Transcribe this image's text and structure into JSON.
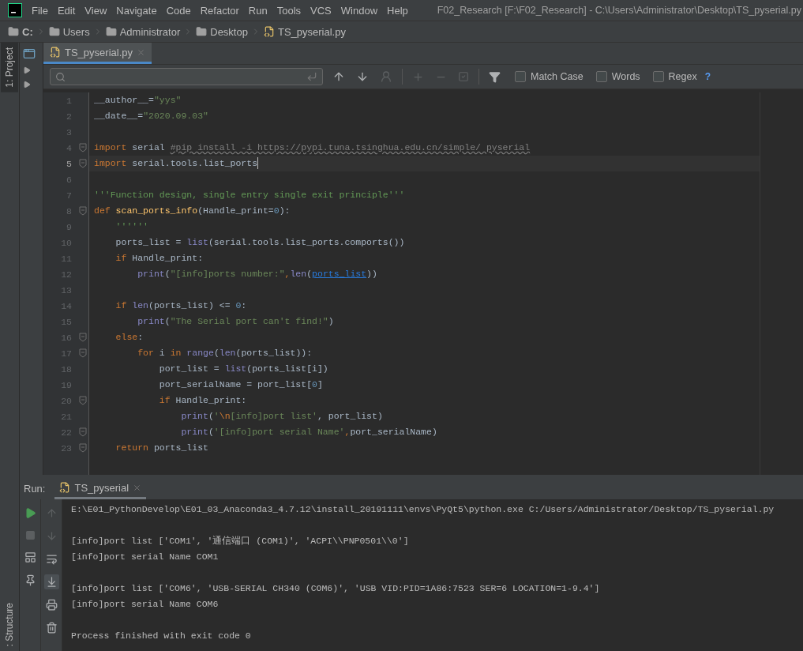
{
  "window": {
    "title": "F02_Research [F:\\F02_Research] - C:\\Users\\Administrator\\Desktop\\TS_pyserial.py"
  },
  "menu": [
    "File",
    "Edit",
    "View",
    "Navigate",
    "Code",
    "Refactor",
    "Run",
    "Tools",
    "VCS",
    "Window",
    "Help"
  ],
  "breadcrumb": [
    {
      "label": "C:",
      "kind": "folder"
    },
    {
      "label": "Users",
      "kind": "folder"
    },
    {
      "label": "Administrator",
      "kind": "folder"
    },
    {
      "label": "Desktop",
      "kind": "folder"
    },
    {
      "label": "TS_pyserial.py",
      "kind": "file"
    }
  ],
  "side_tools": {
    "top": "1: Project",
    "bottom": ": Structure"
  },
  "editor_tabs": [
    {
      "label": "TS_pyserial.py",
      "selected": true
    }
  ],
  "find": {
    "options": [
      {
        "label": "Match Case",
        "checked": false
      },
      {
        "label": "Words",
        "checked": false
      },
      {
        "label": "Regex",
        "checked": false
      }
    ],
    "help": "?"
  },
  "code": [
    {
      "n": "1",
      "current": false,
      "fold": false,
      "tokens": [
        {
          "text": "__author__=",
          "kind": "plain"
        },
        {
          "text": "\"yys\"",
          "kind": "string"
        }
      ]
    },
    {
      "n": "2",
      "current": false,
      "fold": false,
      "tokens": [
        {
          "text": "__date__=",
          "kind": "plain"
        },
        {
          "text": "\"2020.09.03\"",
          "kind": "string"
        }
      ]
    },
    {
      "n": "3",
      "current": false,
      "fold": false
    },
    {
      "n": "4",
      "current": false,
      "fold": true,
      "tokens": [
        {
          "text": "import",
          "kind": "keyword"
        },
        {
          "text": " serial ",
          "kind": "plain"
        },
        {
          "text": "#pip install -i https://pypi.tuna.tsinghua.edu.cn/simple/ pyserial",
          "kind": "comment"
        }
      ]
    },
    {
      "n": "5",
      "current": true,
      "fold": true,
      "tokens": [
        {
          "text": "import",
          "kind": "keyword"
        },
        {
          "text": " serial.tools.list_ports",
          "kind": "plain"
        }
      ]
    },
    {
      "n": "6",
      "current": false,
      "fold": false
    },
    {
      "n": "7",
      "current": false,
      "fold": false,
      "tokens": [
        {
          "text": "'''Function design, single entry single exit principle'''",
          "kind": "doc"
        }
      ]
    },
    {
      "n": "8",
      "current": false,
      "fold": true,
      "tokens": [
        {
          "text": "def ",
          "kind": "keyword"
        },
        {
          "text": "scan_ports_info",
          "kind": "function"
        },
        {
          "text": "(Handle_print=",
          "kind": "plain"
        },
        {
          "text": "0",
          "kind": "number"
        },
        {
          "text": "):",
          "kind": "plain"
        }
      ]
    },
    {
      "n": "9",
      "current": false,
      "fold": false,
      "tokens": [
        {
          "text": "    ''''''",
          "kind": "doc"
        }
      ]
    },
    {
      "n": "10",
      "current": false,
      "fold": false,
      "tokens": [
        {
          "text": "    ports_list = ",
          "kind": "plain"
        },
        {
          "text": "list",
          "kind": "builtin"
        },
        {
          "text": "(serial.tools.list_ports.comports())",
          "kind": "plain"
        }
      ]
    },
    {
      "n": "11",
      "current": false,
      "fold": false,
      "tokens": [
        {
          "text": "    if",
          "kind": "keyword"
        },
        {
          "text": " Handle_print:",
          "kind": "plain"
        }
      ]
    },
    {
      "n": "12",
      "current": false,
      "fold": false,
      "tokens": [
        {
          "text": "        print",
          "kind": "builtin"
        },
        {
          "text": "(",
          "kind": "plain"
        },
        {
          "text": "\"[info]ports number:\"",
          "kind": "string"
        },
        {
          "text": ",",
          "kind": "keyword"
        },
        {
          "text": "len",
          "kind": "builtin"
        },
        {
          "text": "(",
          "kind": "plain"
        },
        {
          "text": "ports_list",
          "kind": "link"
        },
        {
          "text": "))",
          "kind": "plain"
        }
      ]
    },
    {
      "n": "13",
      "current": false,
      "fold": false
    },
    {
      "n": "14",
      "current": false,
      "fold": false,
      "tokens": [
        {
          "text": "    if ",
          "kind": "keyword"
        },
        {
          "text": "len",
          "kind": "builtin"
        },
        {
          "text": "(ports_list) <= ",
          "kind": "plain"
        },
        {
          "text": "0",
          "kind": "number"
        },
        {
          "text": ":",
          "kind": "plain"
        }
      ]
    },
    {
      "n": "15",
      "current": false,
      "fold": false,
      "tokens": [
        {
          "text": "        print",
          "kind": "builtin"
        },
        {
          "text": "(",
          "kind": "plain"
        },
        {
          "text": "\"The Serial port can't find!\"",
          "kind": "string"
        },
        {
          "text": ")",
          "kind": "plain"
        }
      ]
    },
    {
      "n": "16",
      "current": false,
      "fold": true,
      "tokens": [
        {
          "text": "    else",
          "kind": "keyword"
        },
        {
          "text": ":",
          "kind": "plain"
        }
      ]
    },
    {
      "n": "17",
      "current": false,
      "fold": true,
      "tokens": [
        {
          "text": "        for",
          "kind": "keyword"
        },
        {
          "text": " i ",
          "kind": "plain"
        },
        {
          "text": "in ",
          "kind": "keyword"
        },
        {
          "text": "range",
          "kind": "builtin"
        },
        {
          "text": "(",
          "kind": "plain"
        },
        {
          "text": "len",
          "kind": "builtin"
        },
        {
          "text": "(ports_list)):",
          "kind": "plain"
        }
      ]
    },
    {
      "n": "18",
      "current": false,
      "fold": false,
      "tokens": [
        {
          "text": "            port_list = ",
          "kind": "plain"
        },
        {
          "text": "list",
          "kind": "builtin"
        },
        {
          "text": "(ports_list[i])",
          "kind": "plain"
        }
      ]
    },
    {
      "n": "19",
      "current": false,
      "fold": false,
      "tokens": [
        {
          "text": "            port_serialName = port_list[",
          "kind": "plain"
        },
        {
          "text": "0",
          "kind": "number"
        },
        {
          "text": "]",
          "kind": "plain"
        }
      ]
    },
    {
      "n": "20",
      "current": false,
      "fold": true,
      "tokens": [
        {
          "text": "            if",
          "kind": "keyword"
        },
        {
          "text": " Handle_print:",
          "kind": "plain"
        }
      ]
    },
    {
      "n": "21",
      "current": false,
      "fold": false,
      "tokens": [
        {
          "text": "                print",
          "kind": "builtin"
        },
        {
          "text": "(",
          "kind": "plain"
        },
        {
          "text": "'",
          "kind": "string"
        },
        {
          "text": "\\n",
          "kind": "keyword"
        },
        {
          "text": "[info]port list'",
          "kind": "string"
        },
        {
          "text": ", port_list)",
          "kind": "plain"
        }
      ]
    },
    {
      "n": "22",
      "current": false,
      "fold": true,
      "tokens": [
        {
          "text": "                print",
          "kind": "builtin"
        },
        {
          "text": "(",
          "kind": "plain"
        },
        {
          "text": "'[info]port serial Name'",
          "kind": "string"
        },
        {
          "text": ",",
          "kind": "keyword"
        },
        {
          "text": "port_serialName)",
          "kind": "plain"
        }
      ]
    },
    {
      "n": "23",
      "current": false,
      "fold": true,
      "tokens": [
        {
          "text": "    return",
          "kind": "keyword"
        },
        {
          "text": " ports_list",
          "kind": "plain"
        }
      ]
    }
  ],
  "run": {
    "label": "Run:",
    "tabs": [
      {
        "label": "TS_pyserial",
        "selected": true
      }
    ],
    "console": [
      [
        "E:\\E01_PythonDevelop\\E01_03_Anaconda3_4.7.12\\install_20191111\\envs\\PyQt5\\python.exe C:/Users/Administrator/Desktop/TS_pyserial.py"
      ],
      [
        "[info]port list ['COM1', '通信端口 (COM1)', 'ACPI\\\\PNP0501\\\\0']",
        "[info]port serial Name COM1"
      ],
      [
        "[info]port list ['COM6', 'USB-SERIAL CH340 (COM6)', 'USB VID:PID=1A86:7523 SER=6 LOCATION=1-9.4']",
        "[info]port serial Name COM6"
      ],
      [
        "Process finished with exit code 0"
      ]
    ]
  }
}
